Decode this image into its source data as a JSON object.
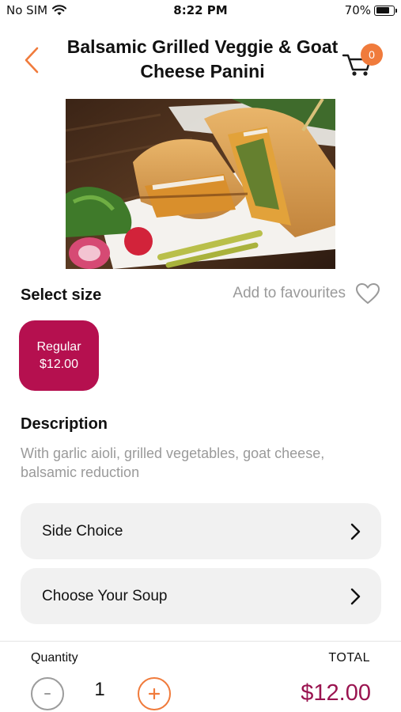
{
  "status_bar": {
    "carrier": "No SIM",
    "time": "8:22 PM",
    "battery": "70%",
    "icons": [
      "wifi-icon",
      "battery-icon"
    ]
  },
  "header": {
    "title": "Balsamic Grilled Veggie & Goat Cheese Panini",
    "back_icon": "chevron-left-icon",
    "cart_icon": "cart-icon",
    "cart_count": "0"
  },
  "product": {
    "image_icon": "panini-photo"
  },
  "size": {
    "heading": "Select size",
    "favourites_label": "Add to favourites",
    "favourites_icon": "heart-icon",
    "options": [
      {
        "name": "Regular",
        "price": "$12.00",
        "selected": true
      }
    ]
  },
  "description": {
    "heading": "Description",
    "text": "With garlic aioli, grilled vegetables, goat cheese, balsamic reduction"
  },
  "options": [
    {
      "label": "Side Choice",
      "icon": "chevron-right-icon"
    },
    {
      "label": "Choose Your Soup",
      "icon": "chevron-right-icon"
    }
  ],
  "footer": {
    "quantity_label": "Quantity",
    "quantity": "1",
    "minus_symbol": "-",
    "plus_symbol": "+",
    "total_label": "TOTAL",
    "total_value": "$12.00"
  },
  "colors": {
    "accent_orange": "#f07b3c",
    "brand_magenta": "#b5104f",
    "total_text": "#9a1450",
    "muted_text": "#9a9a9a",
    "row_background": "#f1f1f1"
  }
}
